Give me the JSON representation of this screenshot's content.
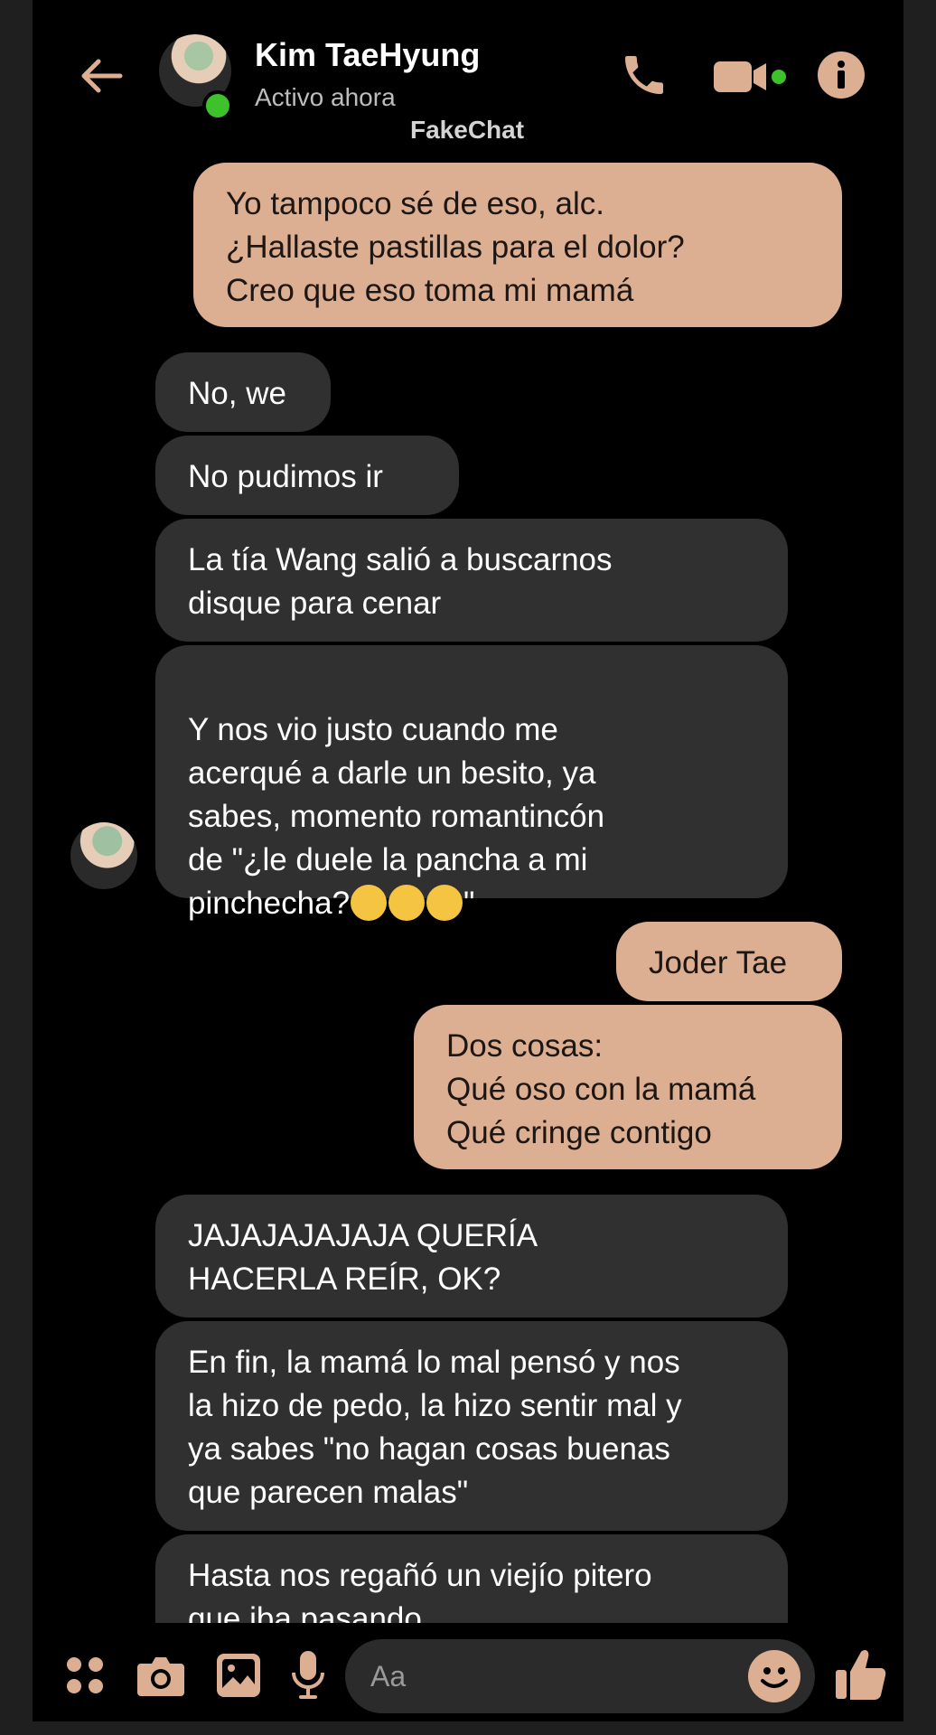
{
  "header": {
    "contact_name": "Kim TaeHyung",
    "status": "Activo ahora",
    "watermark": "FakeChat"
  },
  "messages": [
    {
      "from": "me",
      "text": "Yo tampoco sé de eso, alc.\n¿Hallaste pastillas para el dolor?\nCreo que eso toma mi mamá"
    },
    {
      "from": "them",
      "text": "No, we"
    },
    {
      "from": "them",
      "text": "No pudimos ir"
    },
    {
      "from": "them",
      "text": "La tía Wang salió a buscarnos\ndisque para cenar"
    },
    {
      "from": "them",
      "text_part1": "Y nos vio justo cuando me\nacerqué a darle un besito, ya\nsabes, momento romantincón\nde \"¿le duele la pancha a mi\npinchecha?",
      "text_part2": "\"",
      "emoji": "pleading-face x3"
    },
    {
      "from": "me",
      "text": "Joder Tae"
    },
    {
      "from": "me",
      "text": "Dos cosas:\nQué oso con la mamá\nQué cringe contigo"
    },
    {
      "from": "them",
      "text": "JAJAJAJAJAJA QUERÍA\nHACERLA REÍR, OK?"
    },
    {
      "from": "them",
      "text": "En fin, la mamá lo mal pensó y nos\nla hizo de pedo, la hizo sentir mal y\nya sabes \"no hagan cosas buenas\nque parecen malas\""
    },
    {
      "from": "them",
      "text": "Hasta nos regañó un viejío pitero\nque iba pasando"
    }
  ],
  "composer": {
    "placeholder": "Aa"
  },
  "colors": {
    "accent": "#dcae92",
    "incoming_bubble": "#303030",
    "online": "#3ec22b"
  },
  "icons": [
    "back-arrow-icon",
    "phone-icon",
    "video-camera-icon",
    "info-icon",
    "menu-dots-icon",
    "camera-icon",
    "image-icon",
    "microphone-icon",
    "emoji-icon",
    "thumbs-up-icon"
  ]
}
